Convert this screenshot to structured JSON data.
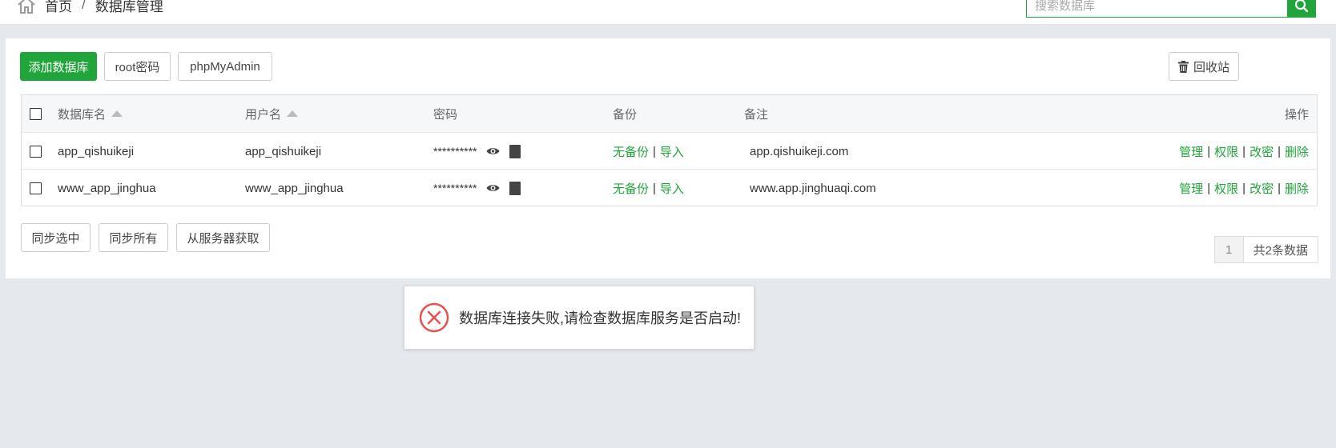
{
  "breadcrumb": {
    "home": "首页",
    "separator": "/",
    "current": "数据库管理"
  },
  "search": {
    "placeholder": "搜索数据库",
    "icon": "search-icon"
  },
  "toolbar": {
    "add_label": "添加数据库",
    "root_label": "root密码",
    "phpmyadmin_label": "phpMyAdmin",
    "recycle_label": "回收站",
    "recycle_icon": "trash-icon"
  },
  "table": {
    "headers": {
      "name": "数据库名",
      "user": "用户名",
      "password": "密码",
      "backup": "备份",
      "note": "备注",
      "actions": "操作"
    },
    "rows": [
      {
        "name": "app_qishuikeji",
        "user": "app_qishuikeji",
        "password": "**********",
        "backup_status": "无备份",
        "import": "导入",
        "note": "app.qishuikeji.com",
        "act_manage": "管理",
        "act_perm": "权限",
        "act_change": "改密",
        "act_delete": "删除"
      },
      {
        "name": "www_app_jinghua",
        "user": "www_app_jinghua",
        "password": "**********",
        "backup_status": "无备份",
        "import": "导入",
        "note": "www.app.jinghuaqi.com",
        "act_manage": "管理",
        "act_perm": "权限",
        "act_change": "改密",
        "act_delete": "删除"
      }
    ]
  },
  "footer": {
    "sync_selected": "同步选中",
    "sync_all": "同步所有",
    "fetch_server": "从服务器获取",
    "page": "1",
    "total": "共2条数据"
  },
  "toast": {
    "message": "数据库连接失败,请检查数据库服务是否启动!",
    "icon": "error-circle-icon"
  },
  "colors": {
    "accent": "#20a53a",
    "error": "#e8514c",
    "background": "#e5e8ec"
  }
}
